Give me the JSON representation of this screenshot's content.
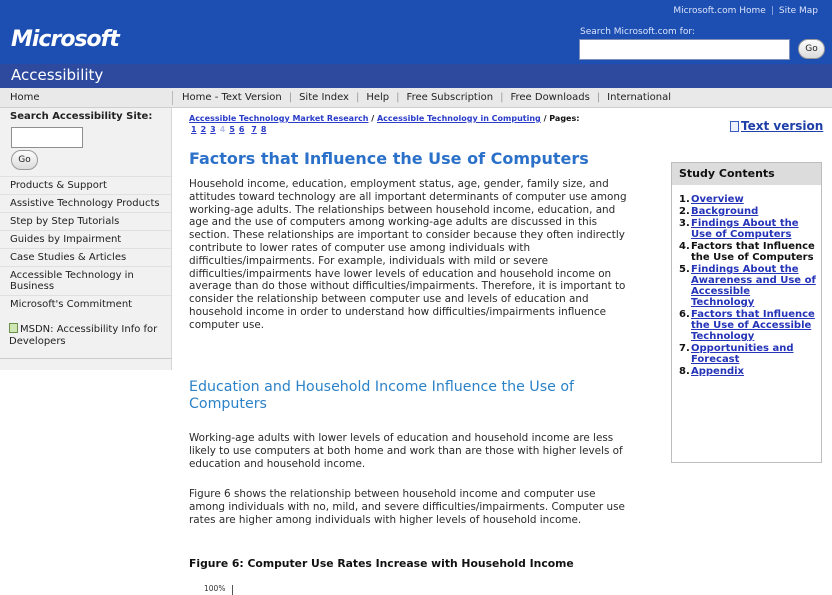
{
  "header": {
    "top_links": [
      "Microsoft.com Home",
      "Site Map"
    ],
    "logo": "Microsoft",
    "search_label": "Search Microsoft.com for:",
    "search_value": "",
    "go_label": "Go"
  },
  "site_bar": {
    "title": "Accessibility"
  },
  "nav": {
    "home": "Home",
    "links": [
      "Home - Text Version",
      "Site Index",
      "Help",
      "Free Subscription",
      "Free Downloads",
      "International"
    ]
  },
  "left": {
    "search_title": "Search Accessibility Site:",
    "search_value": "",
    "go_label": "Go",
    "items": [
      "Products & Support",
      "Assistive Technology Products",
      "Step by Step Tutorials",
      "Guides by Impairment",
      "Case Studies & Articles",
      "Accessible Technology in Business",
      "Microsoft's Commitment"
    ],
    "msdn": "MSDN: Accessibility Info for Developers"
  },
  "breadcrumb": {
    "crumb1": "Accessible Technology Market Research",
    "sep": "/",
    "crumb2": "Accessible Technology in Computing",
    "pages_label": "/ Pages:",
    "pages": [
      "1",
      "2",
      "3",
      "4",
      "5",
      "6",
      "7",
      "8"
    ],
    "current_page": "4"
  },
  "text_version": "Text version",
  "main": {
    "title": "Factors that Influence the Use of Computers",
    "para1": "Household income, education, employment status, age, gender, family size, and attitudes toward technology are all important determinants of computer use among working-age adults. The relationships between household income, education, and age and the use of computers among working-age adults are discussed in this section. These relationships are important to consider because they often indirectly contribute to lower rates of computer use among individuals with difficulties/impairments. For example, individuals with mild or severe difficulties/impairments have lower levels of education and household income on average than do those without difficulties/impairments. Therefore, it is important to consider the relationship between computer use and levels of education and household income in order to understand how difficulties/impairments influence computer use.",
    "h2": "Education and Household Income Influence the Use of Computers",
    "para2": "Working-age adults with lower levels of education and household income are less likely to use computers at both home and work than are those with higher levels of education and household income.",
    "para3": "Figure 6 shows the relationship between household income and computer use among individuals with no, mild, and severe difficulties/impairments. Computer use rates are higher among individuals with higher levels of household income.",
    "figure_title": "Figure 6: Computer Use Rates Increase with Household Income",
    "y_axis_top": "100%"
  },
  "study": {
    "title": "Study Contents",
    "items": [
      {
        "n": "1.",
        "t": "Overview"
      },
      {
        "n": "2.",
        "t": "Background"
      },
      {
        "n": "3.",
        "t": "Findings About the Use of Computers"
      },
      {
        "n": "4.",
        "t": "Factors that Influence the Use of Computers"
      },
      {
        "n": "5.",
        "t": "Findings About the Awareness and Use of Accessible Technology"
      },
      {
        "n": "6.",
        "t": "Factors that Influence the Use of Accessible Technology"
      },
      {
        "n": "7.",
        "t": "Opportunities and Forecast"
      },
      {
        "n": "8.",
        "t": "Appendix"
      }
    ]
  }
}
